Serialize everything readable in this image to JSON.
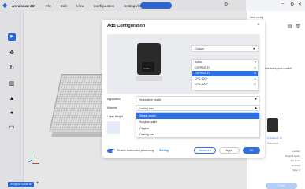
{
  "app": {
    "name": "Aoralscan 3D"
  },
  "menu": [
    "File",
    "Edit",
    "View",
    "Configuration",
    "Settings/Help"
  ],
  "window_controls": {
    "minimize": "–",
    "settings": "⚙",
    "close": "✕"
  },
  "bottom": {
    "tab_label": "Surgical Guide ⊗",
    "add_label": "+"
  },
  "right_panel": {
    "title": "New config",
    "import_hint": "Click to import model",
    "model_name": "E2PRINT-F1",
    "model_sub": "Standard",
    "rows": [
      "Loaded",
      "Surgical Guide",
      "0.1 mm/s",
      "Enabled",
      "Slice: 1"
    ],
    "button": "Print"
  },
  "modal": {
    "title": "Add Configuration",
    "close": "×",
    "custom_select": "Custom",
    "devices": [
      {
        "label": "AoBio",
        "mark": "▾",
        "selected": false
      },
      {
        "label": "E2PRINT-F1",
        "mark": "⊙",
        "selected": false
      },
      {
        "label": "E2PRINT-F1",
        "mark": "⊙",
        "selected": true
      },
      {
        "label": "CPD-100+",
        "mark": "⊙",
        "selected": false
      },
      {
        "label": "CPD-100+",
        "mark": "⊙",
        "selected": false
      }
    ],
    "scanner_logo": "AoBio",
    "application_label": "Application",
    "application_value": "Restorative Model",
    "material_label": "Material",
    "material_value": "Casting wax",
    "layer_height_label": "Layer Height",
    "dropdown_options": [
      {
        "label": "Dental model",
        "selected": true
      },
      {
        "label": "Surgical guide",
        "selected": false
      },
      {
        "label": "Gingiva",
        "selected": false
      },
      {
        "label": "Casting wax",
        "selected": false
      }
    ],
    "auto_processing_label": "Enable Automated processing",
    "setting_link": "Setting",
    "advanced_button": "Advanced",
    "apply_button": "Apply",
    "ok_button": "OK"
  },
  "colors": {
    "accent": "#2f6fe4",
    "panel": "#f3f4f6"
  }
}
